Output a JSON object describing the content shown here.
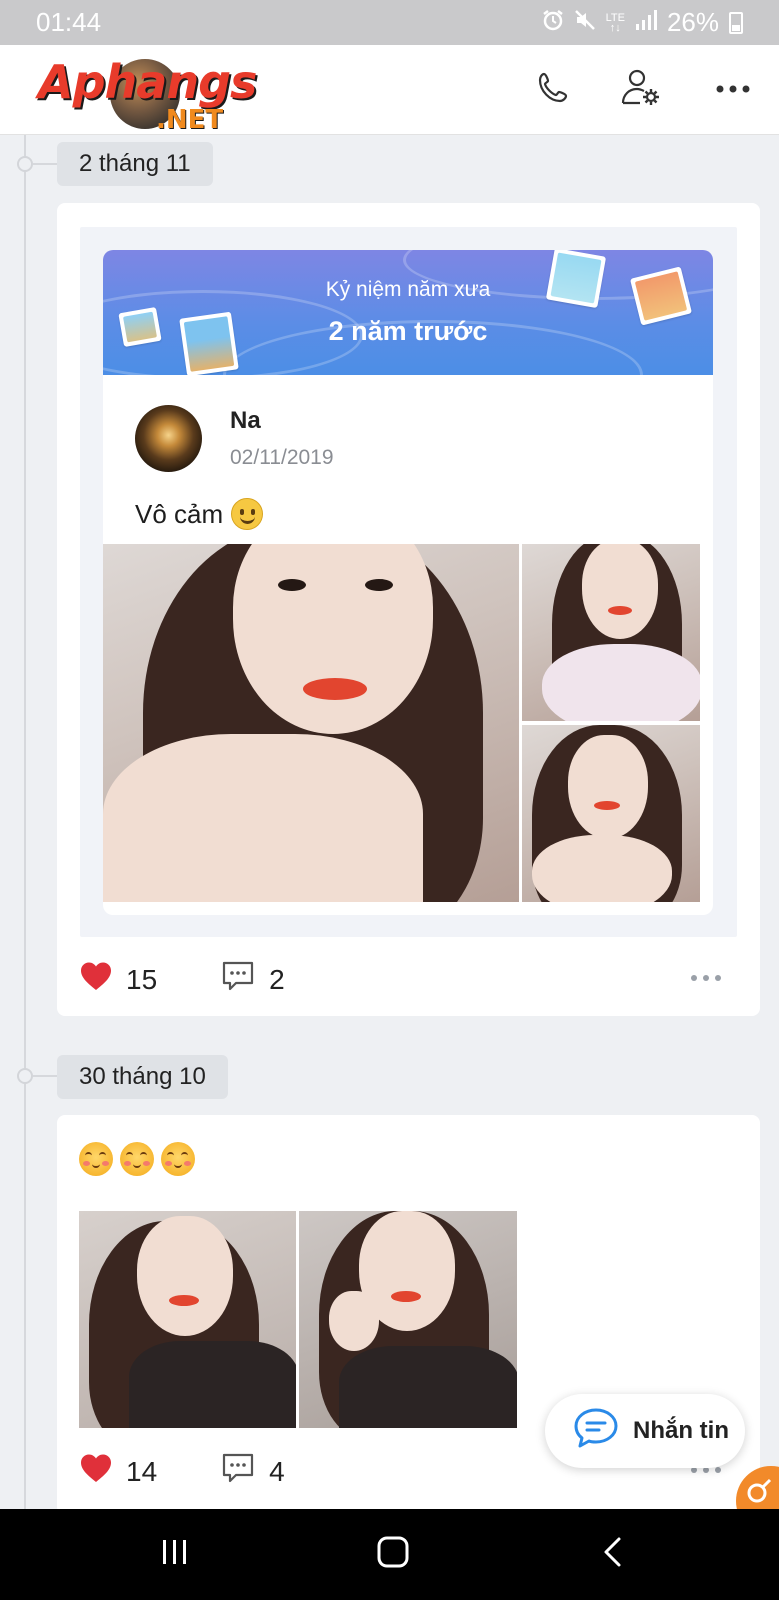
{
  "status_bar": {
    "time": "01:44",
    "network": "LTE",
    "battery": "26%",
    "icons": [
      "alarm-icon",
      "mute-icon",
      "lte-icon",
      "signal-icon",
      "battery-icon"
    ]
  },
  "header": {
    "logo_main": "Aphangs",
    "logo_suffix": ".NET",
    "icons": [
      "phone-icon",
      "user-settings-icon",
      "more-icon"
    ]
  },
  "posts": [
    {
      "date_label": "2 tháng 11",
      "memory": {
        "kicker": "Kỷ niệm năm xưa",
        "title": "2 năm trước",
        "author": "Na",
        "date": "02/11/2019",
        "text": "Vô cảm"
      },
      "likes": "15",
      "comments": "2"
    },
    {
      "date_label": "30 tháng 10",
      "likes": "14",
      "comments": "4"
    }
  ],
  "message_button": {
    "label": "Nhắn tin"
  },
  "colors": {
    "accent_blue": "#4c8ee6",
    "heart": "#e0303a",
    "status_bar": "#c9c9cb",
    "orange": "#f28a2a"
  }
}
